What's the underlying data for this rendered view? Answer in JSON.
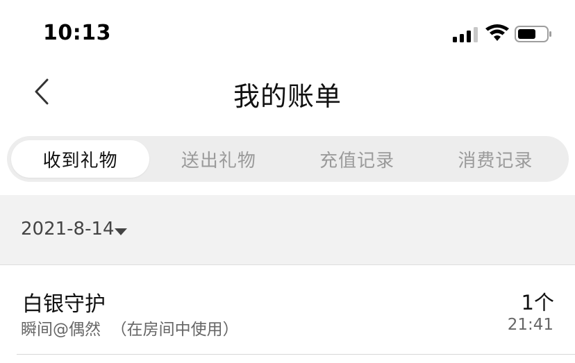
{
  "status_bar": {
    "time": "10:13",
    "icons": [
      "cellular-signal-icon",
      "wifi-icon",
      "battery-icon"
    ]
  },
  "nav": {
    "back_icon": "chevron-left-icon",
    "title": "我的账单"
  },
  "tabs": [
    {
      "label": "收到礼物",
      "active": true
    },
    {
      "label": "送出礼物",
      "active": false
    },
    {
      "label": "充值记录",
      "active": false
    },
    {
      "label": "消费记录",
      "active": false
    }
  ],
  "date_filter": {
    "value": "2021-8-14",
    "icon": "caret-down-icon"
  },
  "records": [
    {
      "name": "白银守护",
      "sender": "瞬间@偶然",
      "note": "（在房间中使用）",
      "count": "1个",
      "time": "21:41"
    }
  ],
  "colors": {
    "tab_track": "#ededed",
    "tab_active_bg": "#ffffff",
    "tab_inactive_text": "#9a9a9a",
    "date_bar_bg": "#f2f2f2"
  }
}
